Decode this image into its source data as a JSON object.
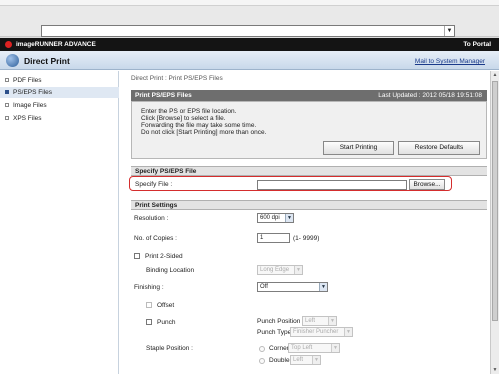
{
  "browser": {
    "address_value": "",
    "dropdown_icon": "chevron-down-icon"
  },
  "banner": {
    "brand": "imageRUNNER ADVANCE",
    "portal_link": "To Portal"
  },
  "appbar": {
    "title": "Direct Print",
    "mail_link": "Mail to System Manager"
  },
  "sidebar": {
    "items": [
      {
        "label": "PDF Files",
        "active": false
      },
      {
        "label": "PS/EPS Files",
        "active": true
      },
      {
        "label": "Image Files",
        "active": false
      },
      {
        "label": "XPS Files",
        "active": false
      }
    ]
  },
  "main": {
    "breadcrumb": "Direct Print : Print PS/EPS Files",
    "panel_title": "Print PS/EPS Files",
    "last_updated": "Last Updated : 2012 05/18 19:51:08",
    "info_lines": [
      "Enter the PS or EPS file location.",
      "Click [Browse] to select a file.",
      "Forwarding the file may take some time.",
      "Do not click [Start Printing] more than once."
    ],
    "start_printing": "Start Printing",
    "restore_defaults": "Restore Defaults",
    "specify_section": "Specify PS/EPS File",
    "specify_label": "Specify File :",
    "file_value": "",
    "browse": "Browse...",
    "print_settings": "Print Settings",
    "resolution_label": "Resolution :",
    "resolution_value": "600 dpi",
    "copies_label": "No. of Copies :",
    "copies_value": "1",
    "copies_range": "(1- 9999)",
    "print2sided_label": "Print 2-Sided",
    "binding_label": "Binding Location",
    "binding_value": "Long Edge",
    "finishing_label": "Finishing :",
    "finishing_value": "Off",
    "offset_label": "Offset",
    "punch_label": "Punch",
    "punch_position_label": "Punch Position",
    "punch_position_value": "Left",
    "punch_type_label": "Punch Type",
    "punch_type_value": "Finisher Puncher",
    "staple_position_label": "Staple Position :",
    "corner_label": "Corner",
    "corner_value": "Top Left",
    "double_label": "Double",
    "double_value": "Left"
  }
}
